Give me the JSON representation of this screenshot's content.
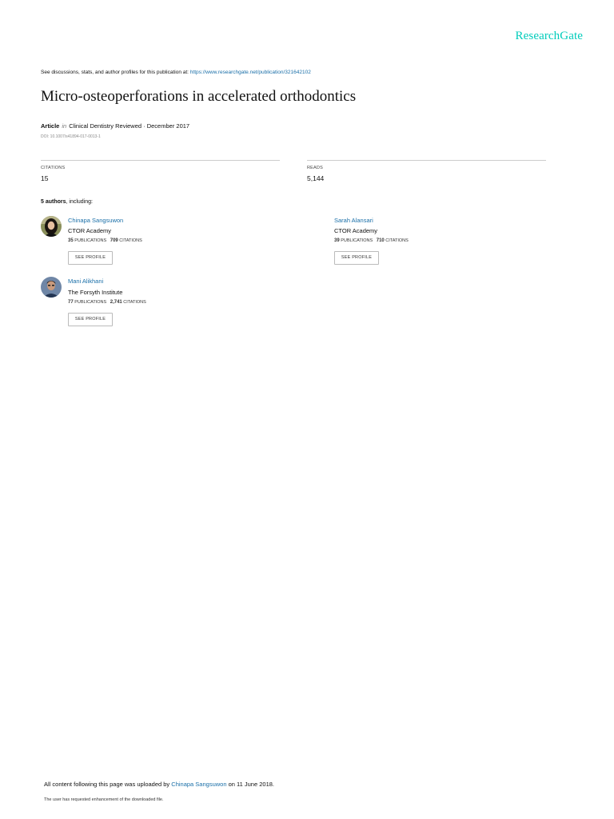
{
  "header": {
    "logo": "ResearchGate"
  },
  "discussion": {
    "text": "See discussions, stats, and author profiles for this publication at: ",
    "url": "https://www.researchgate.net/publication/321642102"
  },
  "publication": {
    "title": "Micro-osteoperforations in accelerated orthodontics",
    "type": "Article",
    "in_word": "in",
    "venue_date": "Clinical Dentistry Reviewed · December 2017",
    "doi": "DOI: 10.1007/s41894-017-0013-1"
  },
  "stats": {
    "citations_label": "CITATIONS",
    "citations_value": "15",
    "reads_label": "READS",
    "reads_value": "5,144"
  },
  "authors_section": {
    "count": "5 authors",
    "suffix": ", including:"
  },
  "authors": [
    {
      "name": "Chinapa Sangsuwon",
      "institution": "CTOR Academy",
      "publications": "35",
      "publications_label": "PUBLICATIONS",
      "citations": "709",
      "citations_label": "CITATIONS",
      "button": "SEE PROFILE"
    },
    {
      "name": "Sarah Alansari",
      "institution": "CTOR Academy",
      "publications": "39",
      "publications_label": "PUBLICATIONS",
      "citations": "710",
      "citations_label": "CITATIONS",
      "button": "SEE PROFILE"
    },
    {
      "name": "Mani Alikhani",
      "institution": "The Forsyth Institute",
      "publications": "77",
      "publications_label": "PUBLICATIONS",
      "citations": "2,741",
      "citations_label": "CITATIONS",
      "button": "SEE PROFILE"
    }
  ],
  "footer": {
    "uploaded_prefix": "All content following this page was uploaded by ",
    "uploader": "Chinapa Sangsuwon",
    "uploaded_suffix": " on 11 June 2018.",
    "note": "The user has requested enhancement of the downloaded file."
  },
  "colors": {
    "brand": "#00ccbb",
    "link": "#1a6fa8"
  }
}
